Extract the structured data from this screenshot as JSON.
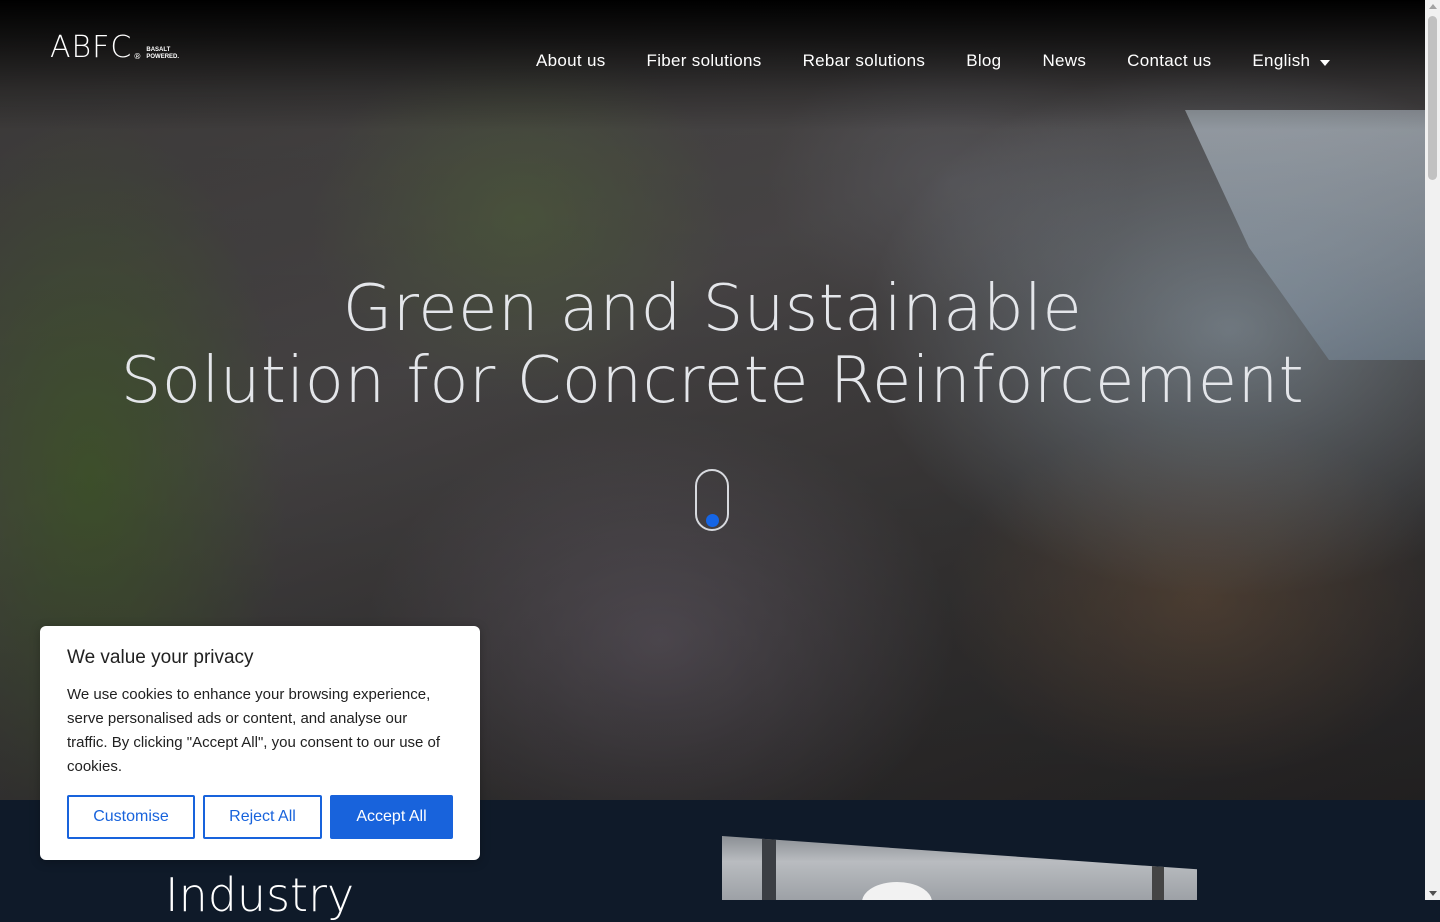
{
  "header": {
    "logo_text": "ABFC",
    "logo_reg": "®",
    "logo_tagline_1": "BASALT",
    "logo_tagline_2": "POWERED.",
    "nav": [
      {
        "label": "About us"
      },
      {
        "label": "Fiber solutions"
      },
      {
        "label": "Rebar solutions"
      },
      {
        "label": "Blog"
      },
      {
        "label": "News"
      },
      {
        "label": "Contact us"
      }
    ],
    "language": "English"
  },
  "hero": {
    "line1": "Green and Sustainable",
    "line2": "Solution for Concrete Reinforcement",
    "scroll_indicator_color": "#1565e6"
  },
  "section": {
    "heading": "Industry"
  },
  "cookie_banner": {
    "title": "We value your privacy",
    "body": "We use cookies to enhance your browsing experience, serve personalised ads or content, and analyse our traffic. By clicking \"Accept All\", you consent to our use of cookies.",
    "customise_label": "Customise",
    "reject_label": "Reject All",
    "accept_label": "Accept All",
    "accent_color": "#1863dc"
  }
}
